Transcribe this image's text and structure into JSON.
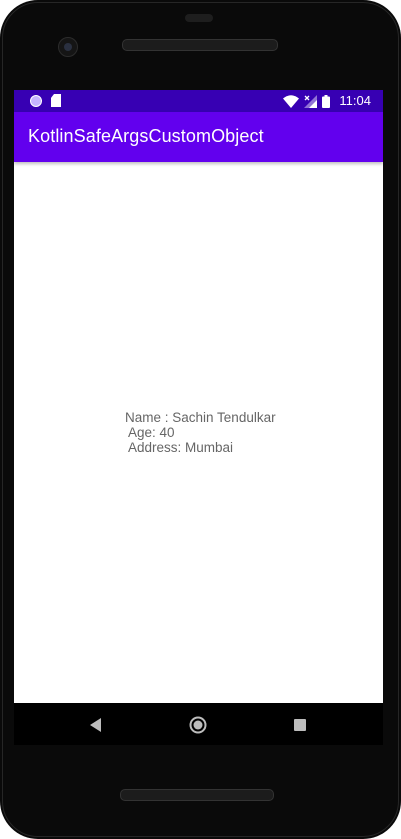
{
  "status_bar": {
    "time": "11:04",
    "icons": [
      "notification-dot-icon",
      "sd-card-icon",
      "wifi-icon",
      "signal-icon",
      "battery-icon"
    ],
    "background": "#3700b3"
  },
  "app_bar": {
    "title": "KotlinSafeArgsCustomObject",
    "background": "#6200ee"
  },
  "content": {
    "details_text": "Name : Sachin Tendulkar\n Age: 40\n Address: Mumbai"
  },
  "navigation": {
    "icons": [
      "back-icon",
      "home-icon",
      "recents-icon"
    ]
  }
}
